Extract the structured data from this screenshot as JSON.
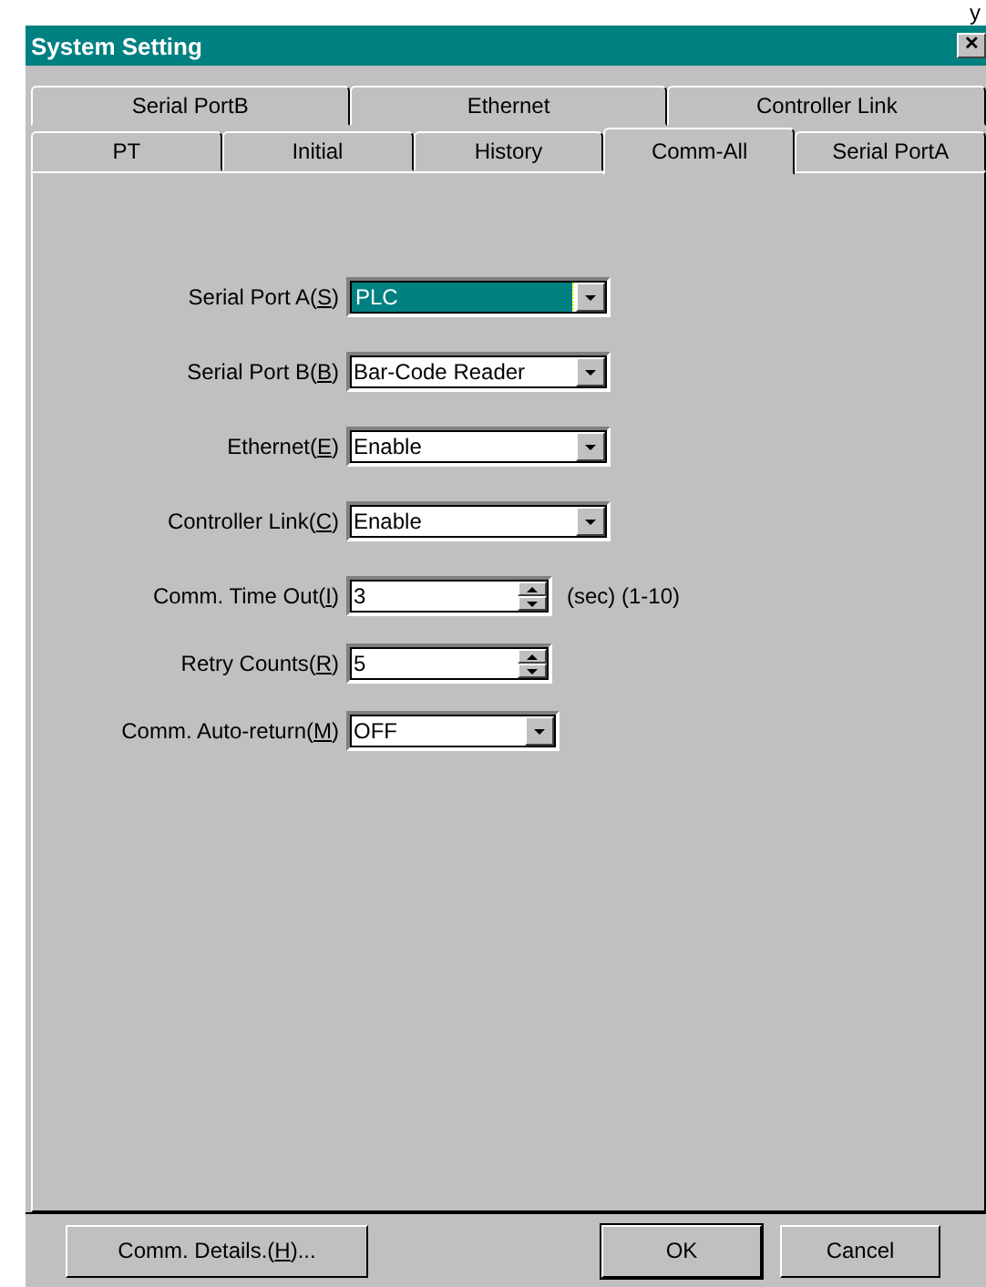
{
  "background_text": "y",
  "window": {
    "title": "System Setting",
    "close": "✕"
  },
  "tab_rows": [
    [
      {
        "label": "Serial PortB",
        "selected": false
      },
      {
        "label": "Ethernet",
        "selected": false
      },
      {
        "label": "Controller Link",
        "selected": false
      }
    ],
    [
      {
        "label": "PT",
        "selected": false
      },
      {
        "label": "Initial",
        "selected": false
      },
      {
        "label": "History",
        "selected": false
      },
      {
        "label": "Comm-All",
        "selected": true
      },
      {
        "label": "Serial PortA",
        "selected": false
      }
    ]
  ],
  "fields": [
    {
      "kind": "combo",
      "label": "Serial Port A(",
      "key": "S",
      "label_end": ")",
      "value": "PLC",
      "focused": true
    },
    {
      "kind": "combo",
      "label": "Serial Port B(",
      "key": "B",
      "label_end": ")",
      "value": "Bar-Code Reader",
      "focused": false
    },
    {
      "kind": "combo",
      "label": "Ethernet(",
      "key": "E",
      "label_end": ")",
      "value": "Enable",
      "focused": false
    },
    {
      "kind": "combo",
      "label": "Controller Link(",
      "key": "C",
      "label_end": ")",
      "value": "Enable",
      "focused": false
    },
    {
      "kind": "spin",
      "label": "Comm. Time Out(",
      "key": "I",
      "label_end": ")",
      "value": "3",
      "unit": "(sec) (1-10)"
    },
    {
      "kind": "spin",
      "label": "Retry Counts(",
      "key": "R",
      "label_end": ")",
      "value": "5"
    },
    {
      "kind": "short_combo",
      "label": "Comm. Auto-return(",
      "key": "M",
      "label_end": ")",
      "value": "OFF",
      "focused": false
    }
  ],
  "buttons": [
    {
      "label": "Comm. Details.(",
      "key": "H",
      "label_end": ")...",
      "kind": "left"
    },
    {
      "label": "OK",
      "kind": "default"
    },
    {
      "label": "Cancel",
      "kind": "normal"
    }
  ]
}
